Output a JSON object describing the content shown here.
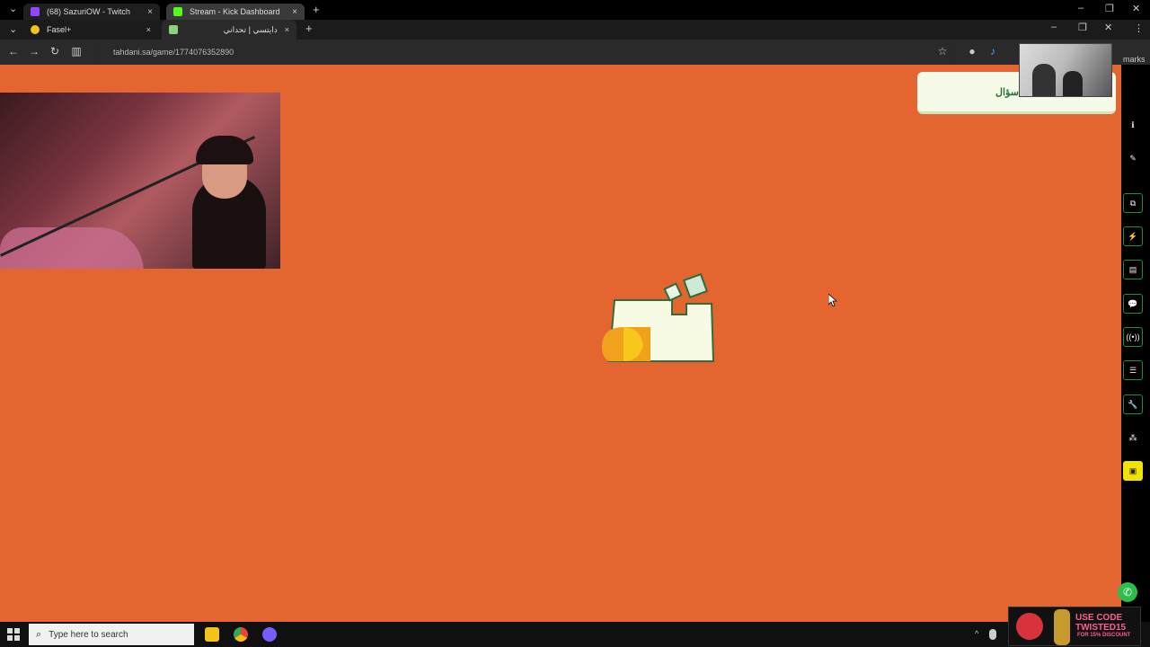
{
  "outer_tabs": [
    {
      "label": "(68) SazuriOW - Twitch",
      "close": "×"
    },
    {
      "label": "Stream - Kick Dashboard",
      "close": "×"
    }
  ],
  "inner_tabs": [
    {
      "label": "Fasel+",
      "close": "×"
    },
    {
      "label": "دايتسي | تحداني",
      "close": "×"
    }
  ],
  "new_tab": "+",
  "address_url": "tahdani.sa/game/1774076352890",
  "bookmarks_label": "marks",
  "question_label": "سؤال",
  "taskbar": {
    "search_placeholder": "Type here to search"
  },
  "sponsor": {
    "line1": "USE CODE",
    "line2": "TWISTED15",
    "line3": "FOR 15% DISCOUNT"
  },
  "colors": {
    "page_bg": "#e56530",
    "card_bg": "#f4fbe9",
    "accent_green": "#1c8f3d"
  }
}
